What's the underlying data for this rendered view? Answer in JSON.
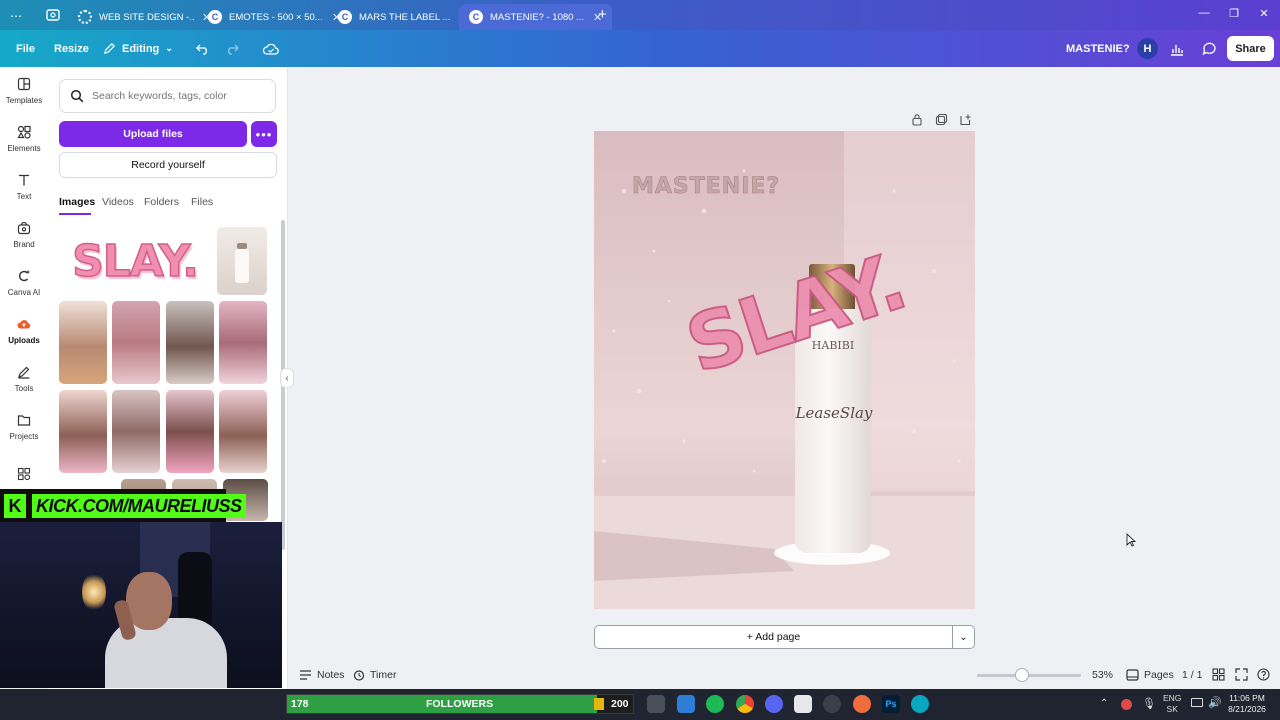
{
  "browser": {
    "tabs": [
      {
        "label": "WEB SITE DESIGN -...",
        "active": false
      },
      {
        "label": "EMOTES - 500 × 50...",
        "active": false
      },
      {
        "label": "MARS THE LABEL ...",
        "active": false
      },
      {
        "label": "MASTENIE? - 1080 ...",
        "active": true
      }
    ],
    "new_tab": "+"
  },
  "header": {
    "file": "File",
    "resize": "Resize",
    "editing": "Editing",
    "design_title": "MASTENIE?",
    "avatar": "H",
    "share": "Share"
  },
  "rail": {
    "items": [
      {
        "label": "Templates",
        "icon": "templates-icon"
      },
      {
        "label": "Elements",
        "icon": "elements-icon"
      },
      {
        "label": "Text",
        "icon": "text-icon"
      },
      {
        "label": "Brand",
        "icon": "brand-icon"
      },
      {
        "label": "Canva AI",
        "icon": "canva-ai-icon"
      },
      {
        "label": "Uploads",
        "icon": "uploads-icon"
      },
      {
        "label": "Tools",
        "icon": "tools-icon"
      },
      {
        "label": "Projects",
        "icon": "projects-icon"
      }
    ]
  },
  "panel": {
    "search_placeholder": "Search keywords, tags, color",
    "upload_files": "Upload files",
    "record_yourself": "Record yourself",
    "tabs": [
      "Images",
      "Videos",
      "Folders",
      "Files"
    ],
    "slay_text": "SLAY."
  },
  "stream": {
    "kick_url": "KICK.COM/MAURELIUSS",
    "followers_label": "FOLLOWERS",
    "followers_count": "178",
    "followers_goal": "200"
  },
  "design": {
    "headline": "MASTENIE?",
    "slay": "SLAY.",
    "bottle_brand": "HABIBI",
    "bottle_script": "LeaseSlay"
  },
  "canvas": {
    "add_page": "+ Add page"
  },
  "footer": {
    "notes": "Notes",
    "timer": "Timer",
    "zoom": "53%",
    "pages_label": "Pages",
    "page_count": "1 / 1"
  },
  "system": {
    "lang": "ENG",
    "region": "SK",
    "time": "11:06 PM",
    "date": "8/21/2026"
  },
  "colors": {
    "upload_button": "#7d2ae8",
    "header_gradient_start": "#16a9c8",
    "header_gradient_end": "#6a3fd6"
  }
}
